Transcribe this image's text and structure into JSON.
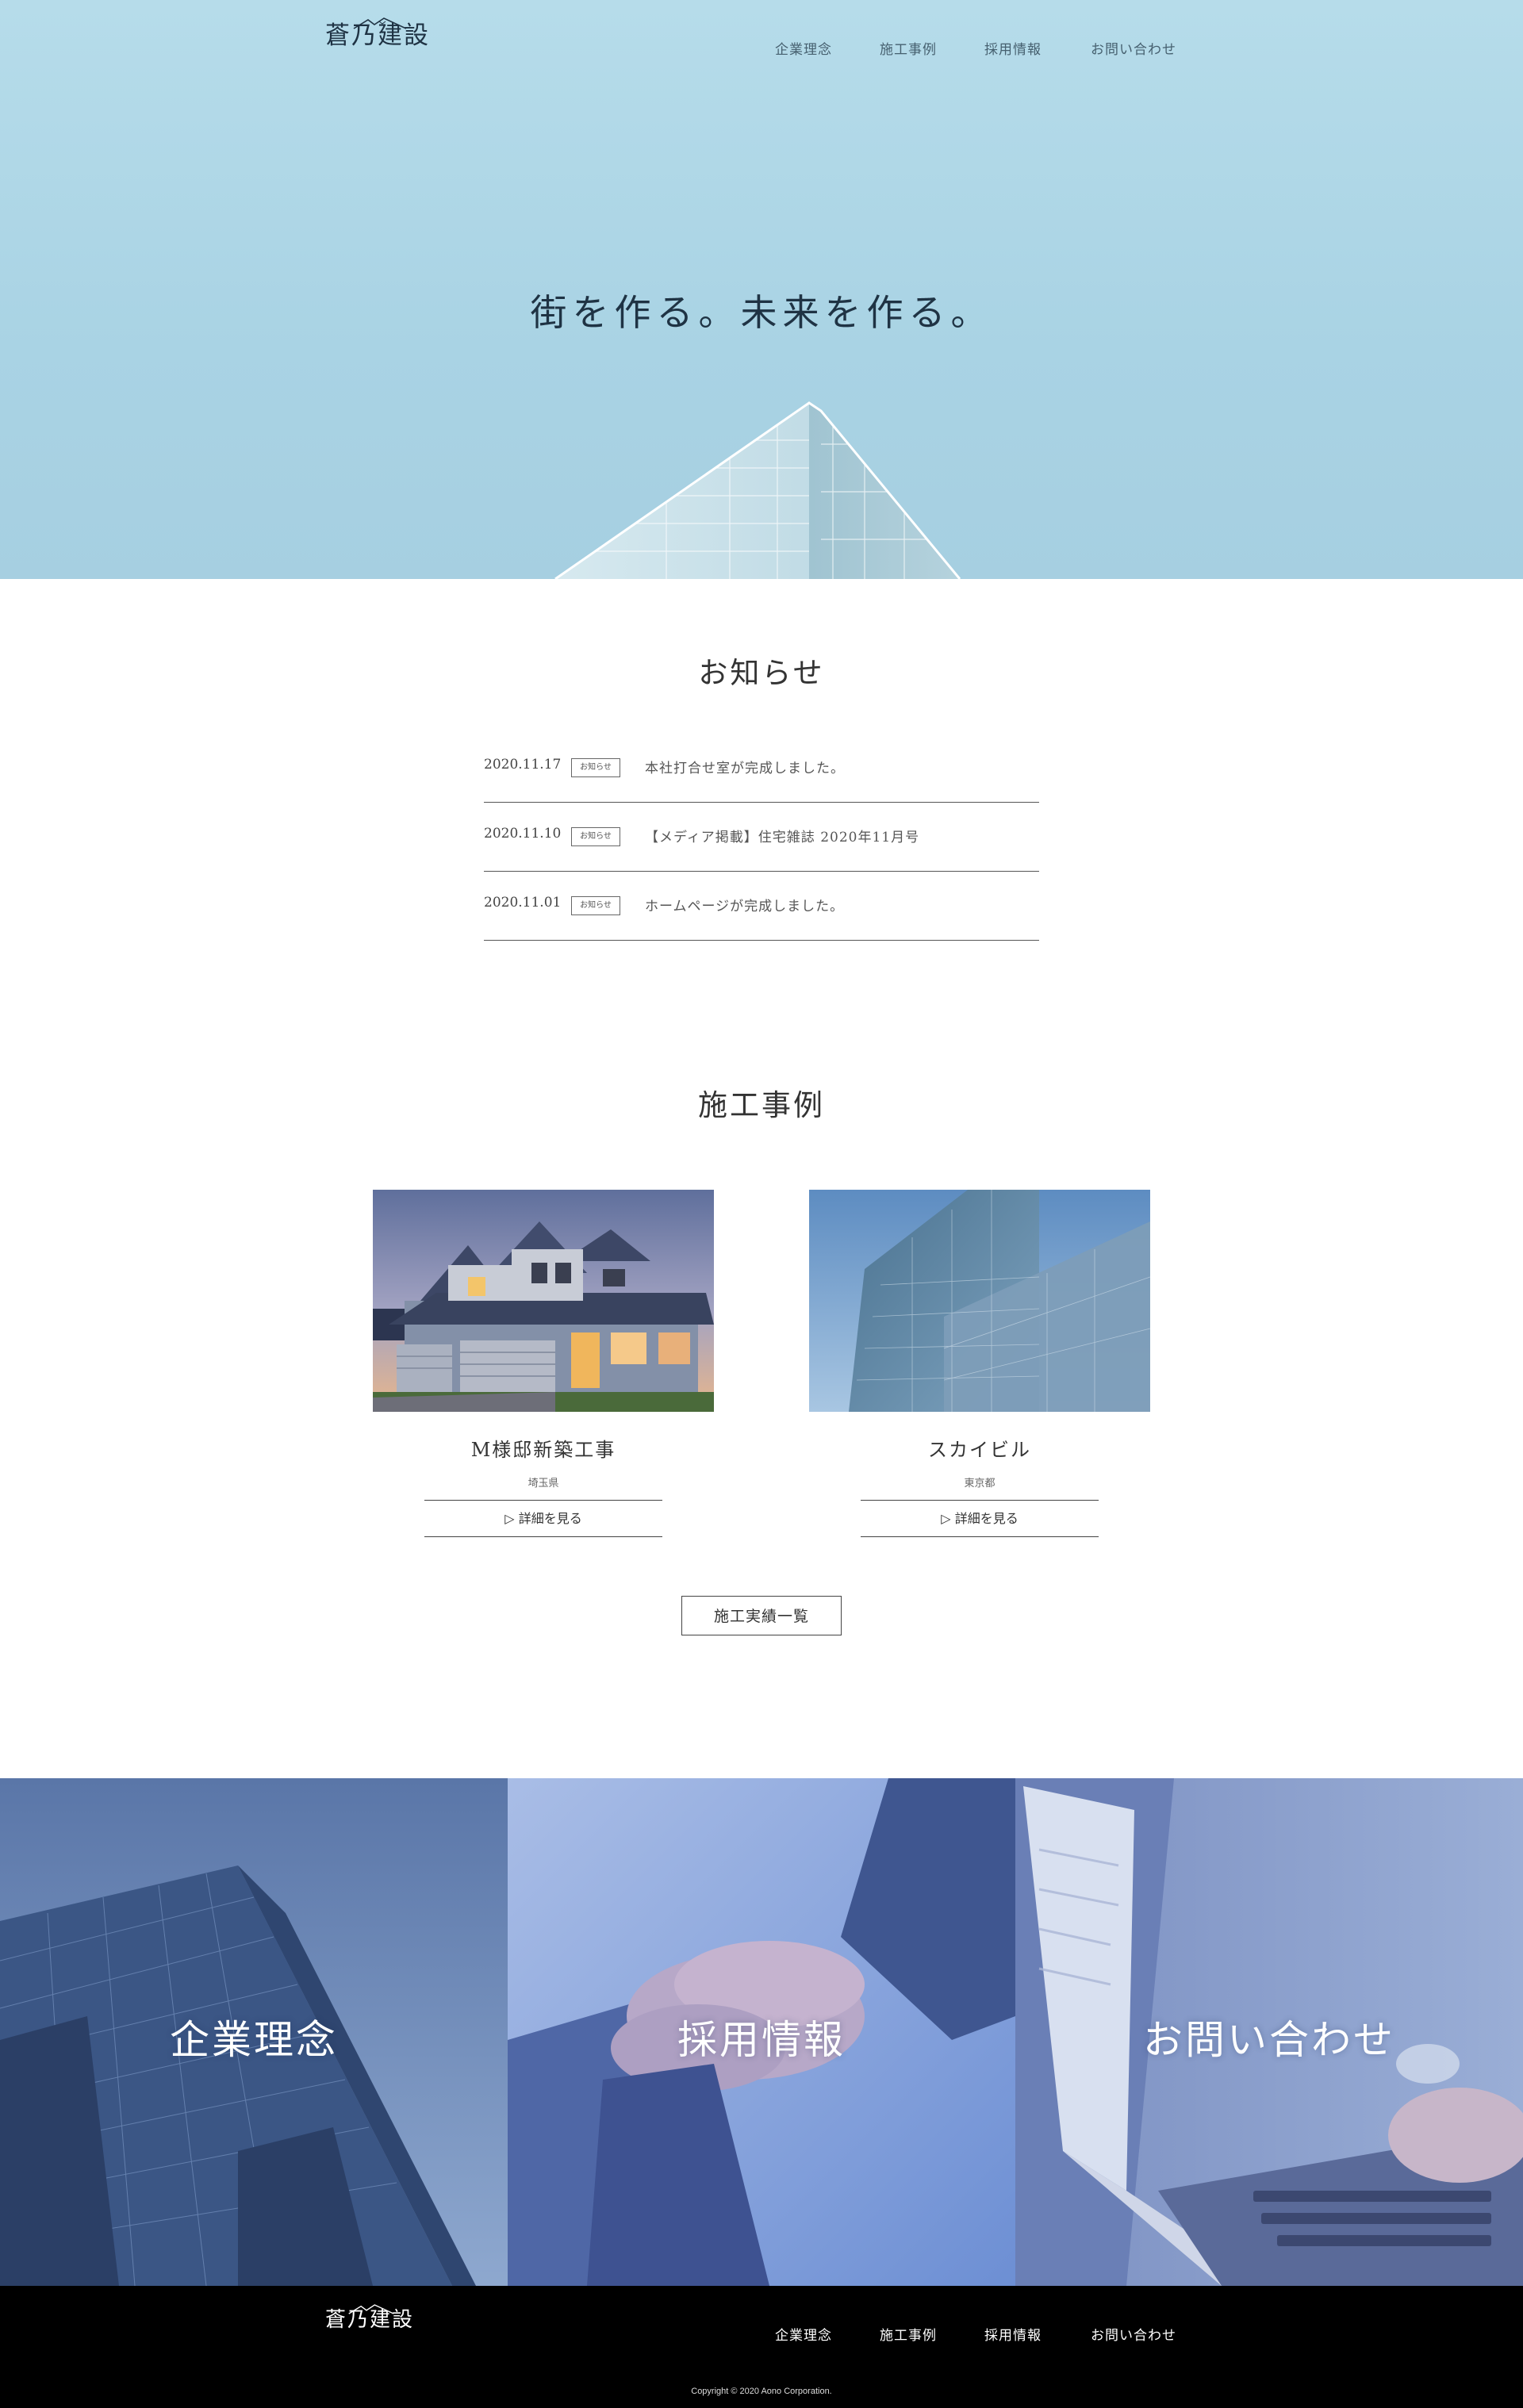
{
  "brand": {
    "name": "蒼乃建設"
  },
  "nav": {
    "items": [
      "企業理念",
      "施工事例",
      "採用情報",
      "お問い合わせ"
    ]
  },
  "hero": {
    "catchcopy": "街を作る。未来を作る。"
  },
  "news": {
    "title": "お知らせ",
    "items": [
      {
        "date": "2020.11.17",
        "tag": "お知らせ",
        "text": "本社打合せ室が完成しました。"
      },
      {
        "date": "2020.11.10",
        "tag": "お知らせ",
        "text": "【メディア掲載】住宅雑誌 2020年11月号"
      },
      {
        "date": "2020.11.01",
        "tag": "お知らせ",
        "text": "ホームページが完成しました。"
      }
    ]
  },
  "works": {
    "title": "施工事例",
    "items": [
      {
        "title": "M様邸新築工事",
        "area": "埼玉県",
        "more": "▷ 詳細を見る"
      },
      {
        "title": "スカイビル",
        "area": "東京都",
        "more": "▷ 詳細を見る"
      }
    ],
    "list_button": "施工実績一覧"
  },
  "panels": [
    {
      "label": "企業理念"
    },
    {
      "label": "採用情報"
    },
    {
      "label": "お問い合わせ"
    }
  ],
  "footer": {
    "brand": "蒼乃建設",
    "nav": [
      "企業理念",
      "施工事例",
      "採用情報",
      "お問い合わせ"
    ],
    "copyright": "Copyright © 2020 Aono Corporation."
  },
  "colors": {
    "hero_bg": "#b6dcea",
    "panel_tint": "#6f8fd6",
    "footer_bg": "#000000"
  }
}
